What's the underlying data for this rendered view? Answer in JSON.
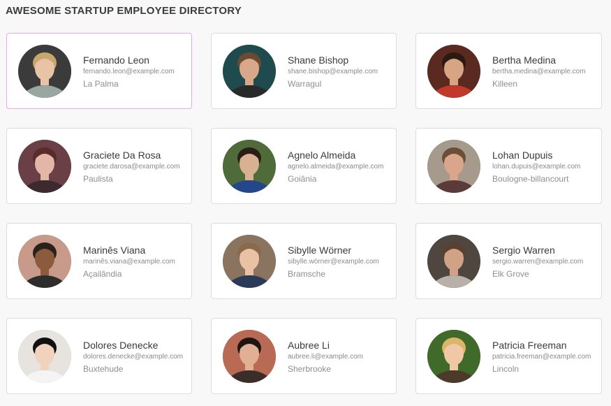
{
  "page": {
    "title": "AWESOME STARTUP EMPLOYEE DIRECTORY"
  },
  "theme": {
    "background": "#f8f8f8",
    "card_border": "#dcdcdc",
    "selected_border": "#e6a9ea"
  },
  "employees": [
    {
      "name": "Fernando Leon",
      "email": "fernando.leon@example.com",
      "city": "La Palma",
      "selected": true,
      "avatar": {
        "bg": "#3b3b3b",
        "skin": "#e8c3a6",
        "hair": "#c9a66b",
        "shirt": "#9aa7a0"
      }
    },
    {
      "name": "Shane Bishop",
      "email": "shane.bishop@example.com",
      "city": "Warragul",
      "selected": false,
      "avatar": {
        "bg": "#1f4b4f",
        "skin": "#d9a88a",
        "hair": "#6a4a30",
        "shirt": "#2a2a2a"
      }
    },
    {
      "name": "Bertha Medina",
      "email": "bertha.medina@example.com",
      "city": "Killeen",
      "selected": false,
      "avatar": {
        "bg": "#5a2a20",
        "skin": "#d7a584",
        "hair": "#2b1a12",
        "shirt": "#c0392b"
      }
    },
    {
      "name": "Graciete Da Rosa",
      "email": "graciete.darosa@example.com",
      "city": "Paulista",
      "selected": false,
      "avatar": {
        "bg": "#6a3f46",
        "skin": "#e2b7a8",
        "hair": "#5b2b2b",
        "shirt": "#3d2a2e"
      }
    },
    {
      "name": "Agnelo Almeida",
      "email": "agnelo.almeida@example.com",
      "city": "Goiânia",
      "selected": false,
      "avatar": {
        "bg": "#4f6b3a",
        "skin": "#d8b092",
        "hair": "#2a1e16",
        "shirt": "#24468a"
      }
    },
    {
      "name": "Lohan Dupuis",
      "email": "lohan.dupuis@example.com",
      "city": "Boulogne-billancourt",
      "selected": false,
      "avatar": {
        "bg": "#a69a8c",
        "skin": "#d9a58b",
        "hair": "#6b4e38",
        "shirt": "#5b3a3a"
      }
    },
    {
      "name": "Marinês Viana",
      "email": "marinês.viana@example.com",
      "city": "Açailândia",
      "selected": false,
      "avatar": {
        "bg": "#c79a8a",
        "skin": "#8c5a3c",
        "hair": "#2b211b",
        "shirt": "#2d2d2d"
      }
    },
    {
      "name": "Sibylle Wörner",
      "email": "sibylle.wörner@example.com",
      "city": "Bramsche",
      "selected": false,
      "avatar": {
        "bg": "#8a7460",
        "skin": "#e9c1a5",
        "hair": "#8b6a4a",
        "shirt": "#2c3a5a"
      }
    },
    {
      "name": "Sergio Warren",
      "email": "sergio.warren@example.com",
      "city": "Elk Grove",
      "selected": false,
      "avatar": {
        "bg": "#4f463f",
        "skin": "#d1a286",
        "hair": "#5a4030",
        "shirt": "#b9b0a8"
      }
    },
    {
      "name": "Dolores Denecke",
      "email": "dolores.denecke@example.com",
      "city": "Buxtehude",
      "selected": false,
      "avatar": {
        "bg": "#e7e4df",
        "skin": "#f0d2bd",
        "hair": "#111111",
        "shirt": "#f4f4f4"
      }
    },
    {
      "name": "Aubree Li",
      "email": "aubree.li@example.com",
      "city": "Sherbrooke",
      "selected": false,
      "avatar": {
        "bg": "#b96a55",
        "skin": "#e1b094",
        "hair": "#1e1613",
        "shirt": "#3b2e2a"
      }
    },
    {
      "name": "Patricia Freeman",
      "email": "patricia.freeman@example.com",
      "city": "Lincoln",
      "selected": false,
      "avatar": {
        "bg": "#3f6a2a",
        "skin": "#f0c8a8",
        "hair": "#d9b66a",
        "shirt": "#4c3a2a"
      }
    }
  ]
}
